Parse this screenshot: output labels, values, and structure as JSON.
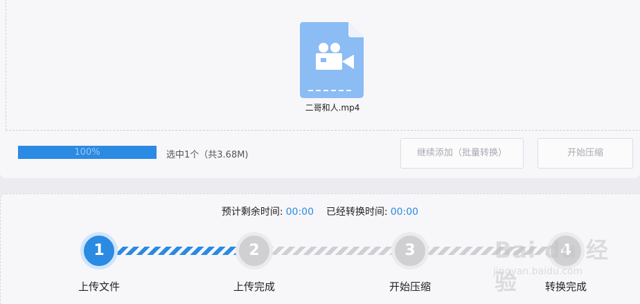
{
  "upload": {
    "file_name": "二哥和人.mp4",
    "progress_percent": 100,
    "progress_text": "100%",
    "selection_info": "选中1个（共3.68M)"
  },
  "buttons": {
    "add_more": "继续添加（批量转换）",
    "start_compress": "开始压缩"
  },
  "timing": {
    "remaining_label": "预计剩余时间:",
    "remaining_value": "00:00",
    "elapsed_label": "已经转换时间:",
    "elapsed_value": "00:00"
  },
  "steps": [
    {
      "number": "1",
      "label": "上传文件",
      "state": "active"
    },
    {
      "number": "2",
      "label": "上传完成",
      "state": "idle"
    },
    {
      "number": "3",
      "label": "开始压缩",
      "state": "idle"
    },
    {
      "number": "4",
      "label": "转换完成",
      "state": "idle"
    }
  ],
  "watermark": {
    "text": "Bai du 经验",
    "sub": "jingyan.baidu.com"
  },
  "colors": {
    "accent": "#2b8ae2",
    "file_icon": "#8bbcf4",
    "idle_step": "#d0d0d3"
  }
}
